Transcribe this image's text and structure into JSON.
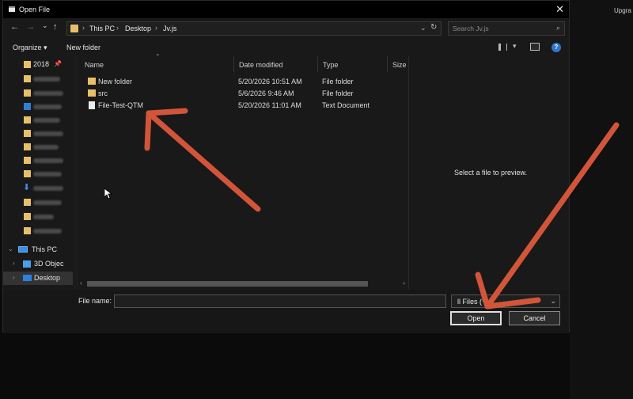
{
  "window": {
    "title": "Open File",
    "close_glyph": "✕"
  },
  "background": {
    "upgrade_label": "Upgra"
  },
  "nav": {
    "back": "←",
    "forward": "→",
    "recent": "⌄",
    "up": "↑",
    "breadcrumbs": [
      "This PC",
      "Desktop",
      "Jv.js"
    ],
    "search_placeholder": "Search Jv.js"
  },
  "toolbar": {
    "organize_label": "Organize ▾",
    "new_folder_label": "New folder",
    "help_glyph": "?"
  },
  "sidebar": {
    "quick_access_items": [
      {
        "label": "2018",
        "icon": "folder-icon",
        "pinned": true
      },
      {
        "label": "",
        "icon": "folder-icon",
        "blurred": true
      },
      {
        "label": "",
        "icon": "folder-icon",
        "blurred": true
      },
      {
        "label": "",
        "icon": "blue-folder-icon",
        "blurred": true
      },
      {
        "label": "",
        "icon": "folder-icon",
        "blurred": true
      },
      {
        "label": "",
        "icon": "folder-icon",
        "blurred": true
      },
      {
        "label": "",
        "icon": "folder-icon",
        "blurred": true
      },
      {
        "label": "",
        "icon": "folder-icon",
        "blurred": true
      },
      {
        "label": "",
        "icon": "folder-icon",
        "blurred": true
      },
      {
        "label": "",
        "icon": "download-icon",
        "blurred": true
      },
      {
        "label": "",
        "icon": "folder-icon",
        "blurred": true
      },
      {
        "label": "",
        "icon": "folder-icon",
        "blurred": true
      },
      {
        "label": "",
        "icon": "folder-icon",
        "blurred": true
      }
    ],
    "this_pc_label": "This PC",
    "objects_label": "3D Objec",
    "desktop_label": "Desktop"
  },
  "columns": {
    "name": "Name",
    "date": "Date modified",
    "type": "Type",
    "size": "Size"
  },
  "files": [
    {
      "name": "New folder",
      "date": "5/20/2026 10:51 AM",
      "type": "File folder",
      "icon": "folder-icon"
    },
    {
      "name": "src",
      "date": "5/6/2026 9:46 AM",
      "type": "File folder",
      "icon": "folder-icon"
    },
    {
      "name": "File-Test-QTM",
      "date": "5/20/2026 11:01 AM",
      "type": "Text Document",
      "icon": "text-document-icon"
    }
  ],
  "preview": {
    "message": "Select a file to preview."
  },
  "footer": {
    "file_name_label": "File name:",
    "file_name_value": "",
    "file_type_value": "ll Files (*",
    "open_label": "Open",
    "cancel_label": "Cancel"
  },
  "colors": {
    "arrow": "#d2553a",
    "folder": "#e8c06a",
    "accent": "#2e74d0"
  }
}
